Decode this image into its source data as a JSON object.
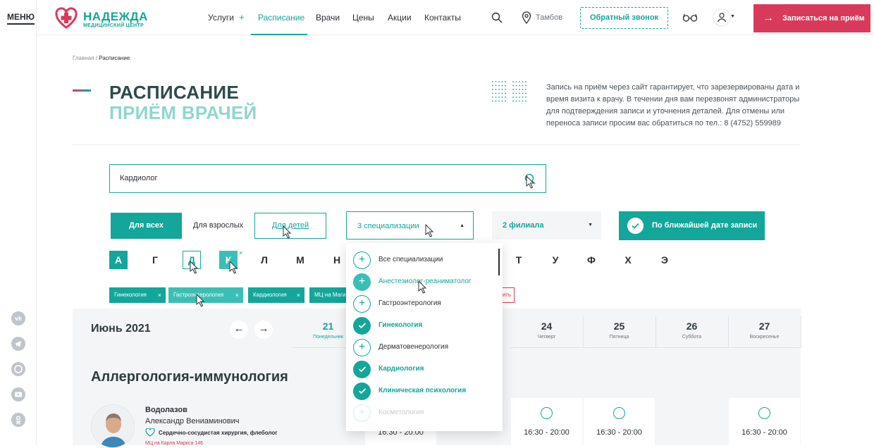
{
  "rail": {
    "menu_label": "МЕНЮ",
    "socials": [
      "vk-icon",
      "telegram-icon",
      "whatsapp-icon",
      "youtube-icon",
      "odnoklassniki-icon"
    ]
  },
  "header": {
    "logo_name": "НАДЕЖДА",
    "logo_sub": "МЕДИЦИНСКИЙ ЦЕНТР",
    "nav": [
      "Услуги",
      "Расписание",
      "Врачи",
      "Цены",
      "Акции",
      "Контакты"
    ],
    "nav_active": "Расписание",
    "city": "Тамбов",
    "callback": "Обратный звонок",
    "cta": "Записаться на приём"
  },
  "breadcrumb": {
    "home": "Главная",
    "sep": "/",
    "current": "Расписание"
  },
  "page": {
    "title_1": "РАСПИСАНИЕ",
    "title_2": "ПРИЁМ ВРАЧЕЙ",
    "intro": "Запись на приём через сайт гарантирует, что зарезервированы дата и время визита к врачу. В течении дня вам перезвонят администраторы для подтверждения записи и уточнения деталей. Для отмены или переноса записи просим вас обратиться по тел.: 8 (4752) 559989"
  },
  "search": {
    "value": "Кардиолог"
  },
  "filters": {
    "audience": [
      "Для всех",
      "Для взрослых",
      "Для детей"
    ],
    "specialties_selected": "3 специализации",
    "branches_selected": "2 филиала",
    "nearest": "По ближайшей дате записи"
  },
  "letters": [
    {
      "char": "А",
      "state": "filled"
    },
    {
      "char": "Г",
      "state": "plain"
    },
    {
      "char": "Д",
      "state": "outline"
    },
    {
      "char": "К",
      "state": "filled2"
    },
    {
      "char": "Л",
      "state": "plain"
    },
    {
      "char": "М",
      "state": "plain"
    },
    {
      "char": "Н",
      "state": "plain"
    },
    {
      "char": "Т",
      "state": "plain"
    },
    {
      "char": "У",
      "state": "plain"
    },
    {
      "char": "Ф",
      "state": "plain"
    },
    {
      "char": "Х",
      "state": "plain"
    },
    {
      "char": "Э",
      "state": "plain"
    }
  ],
  "chips": [
    {
      "label": "Гинекология",
      "color": "#13a69a"
    },
    {
      "label": "Гастроэнтерология",
      "color": "#3bbfb5"
    },
    {
      "label": "Кардиология",
      "color": "#13a69a"
    },
    {
      "label": "МЦ на Маги",
      "color": "#13a69a"
    }
  ],
  "chip_clear": "ить",
  "schedule": {
    "month": "Июнь 2021",
    "days": [
      {
        "num": "21",
        "name": "Понедельник",
        "active": true
      },
      {
        "num": "24",
        "name": "Четверг"
      },
      {
        "num": "25",
        "name": "Пятница"
      },
      {
        "num": "26",
        "name": "Суббота"
      },
      {
        "num": "27",
        "name": "Воскресенье"
      }
    ]
  },
  "section_title": "Аллергология-иммунология",
  "doctor": {
    "last_name": "Водолазов",
    "first_name": "Александр Вениаминович",
    "specialty": "Сердечно-сосудистая хирургия, флеболог",
    "clinic": "МЦ на Карла Маркса 146"
  },
  "slots": [
    "16:30 - 20:00",
    "16:30 - 20:00",
    "16:30 - 20:00",
    "16:30 - 20:00"
  ],
  "dropdown": [
    {
      "label": "Все специализации",
      "checked": false,
      "state": "plain"
    },
    {
      "label": "Анестезиолог-реаниматолог",
      "checked": false,
      "state": "hover"
    },
    {
      "label": "Гастроэнтерология",
      "checked": false,
      "state": "plain"
    },
    {
      "label": "Гинекология",
      "checked": true,
      "state": "on"
    },
    {
      "label": "Дерматовенерология",
      "checked": false,
      "state": "plain"
    },
    {
      "label": "Кардиология",
      "checked": true,
      "state": "on"
    },
    {
      "label": "Клиническая психология",
      "checked": true,
      "state": "on"
    },
    {
      "label": "Косметология",
      "checked": false,
      "state": "fade"
    }
  ],
  "colors": {
    "accent": "#13a69a",
    "accent_light": "#8fd6d0",
    "brand_red": "#d93a5c"
  }
}
